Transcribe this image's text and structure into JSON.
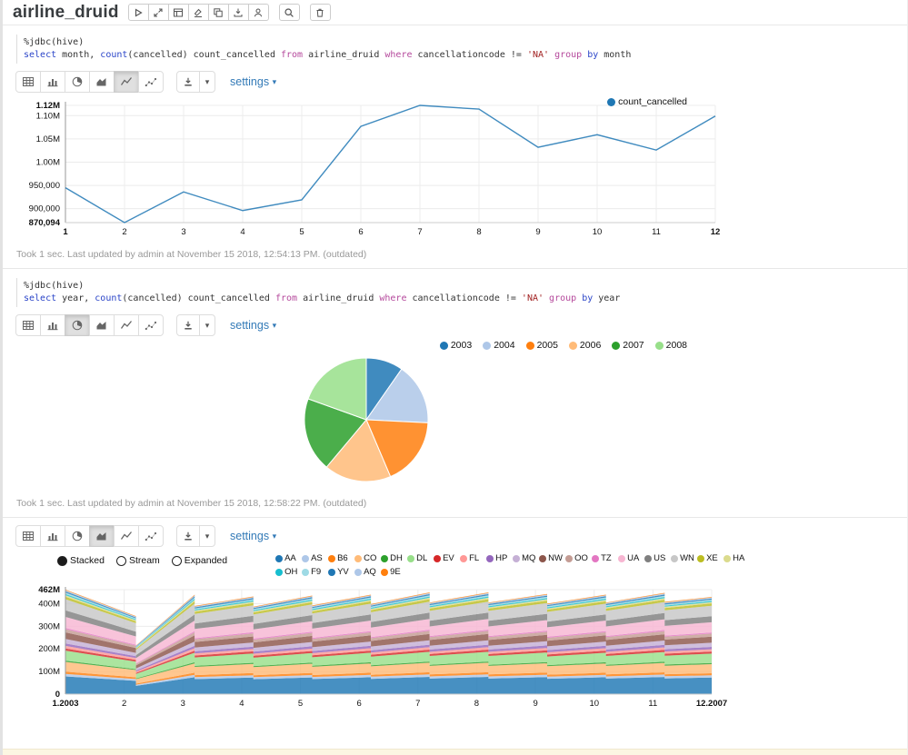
{
  "header": {
    "title": "airline_druid",
    "toolbar_buttons": [
      {
        "icon": "play",
        "name": "run-all-button"
      },
      {
        "icon": "expand",
        "name": "show-hide-code-button"
      },
      {
        "icon": "output",
        "name": "show-hide-output-button"
      },
      {
        "icon": "erase",
        "name": "clear-output-button"
      },
      {
        "icon": "clone",
        "name": "clone-note-button"
      },
      {
        "icon": "export",
        "name": "export-note-button"
      },
      {
        "icon": "commit",
        "name": "version-control-button"
      }
    ],
    "search_button": {
      "icon": "search",
      "name": "search-button"
    },
    "trash_button": {
      "icon": "trash",
      "name": "remove-note-button"
    }
  },
  "toolbar_common": {
    "chart_buttons": [
      "table",
      "bar",
      "pie",
      "area",
      "line",
      "scatter"
    ],
    "settings_label": "settings",
    "settings_caret": "▾",
    "download_caret": "▾"
  },
  "paragraphs": [
    {
      "name": "cancelled-by-month-paragraph",
      "code_lines": [
        [
          [
            "%jdbc(hive)",
            "pl"
          ]
        ],
        [
          [
            "select",
            "kw1"
          ],
          [
            " month, ",
            "pl"
          ],
          [
            "count",
            "kw1"
          ],
          [
            "(cancelled) count_cancelled ",
            "pl"
          ],
          [
            "from",
            "kw2"
          ],
          [
            " airline_druid ",
            "pl"
          ],
          [
            "where",
            "kw2"
          ],
          [
            " cancellationcode != ",
            "pl"
          ],
          [
            "'NA'",
            "str"
          ],
          [
            " ",
            "pl"
          ],
          [
            "group",
            "kw2"
          ],
          [
            " ",
            "pl"
          ],
          [
            "by",
            "kw1"
          ],
          [
            " month",
            "pl"
          ]
        ]
      ],
      "active_chart": "line",
      "status": "Took 1 sec. Last updated by admin at November 15 2018, 12:54:13 PM. (outdated)",
      "chart_data": {
        "type": "line",
        "x": [
          1,
          2,
          3,
          4,
          5,
          6,
          7,
          8,
          9,
          10,
          11,
          12
        ],
        "series": [
          {
            "name": "count_cancelled",
            "color": "#1f77b4",
            "values": [
              945000,
              870094,
              936000,
              896000,
              919000,
              1077000,
              1122000,
              1114000,
              1032000,
              1059000,
              1026000,
              1099000
            ]
          }
        ],
        "ylim": [
          870094,
          1122000
        ],
        "yticks": [
          {
            "label": "1.12M",
            "value": 1122000,
            "bold": true
          },
          {
            "label": "1.10M",
            "value": 1100000
          },
          {
            "label": "1.05M",
            "value": 1050000
          },
          {
            "label": "1.00M",
            "value": 1000000
          },
          {
            "label": "950,000",
            "value": 950000
          },
          {
            "label": "900,000",
            "value": 900000
          },
          {
            "label": "870,094",
            "value": 870094,
            "bold": true
          }
        ],
        "xticks": [
          {
            "label": "1",
            "pos": 1,
            "bold": true
          },
          {
            "label": "2",
            "pos": 2
          },
          {
            "label": "3",
            "pos": 3
          },
          {
            "label": "4",
            "pos": 4
          },
          {
            "label": "5",
            "pos": 5
          },
          {
            "label": "6",
            "pos": 6
          },
          {
            "label": "7",
            "pos": 7
          },
          {
            "label": "8",
            "pos": 8
          },
          {
            "label": "9",
            "pos": 9
          },
          {
            "label": "10",
            "pos": 10
          },
          {
            "label": "11",
            "pos": 11
          },
          {
            "label": "12",
            "pos": 12,
            "bold": true
          }
        ],
        "legend": [
          {
            "label": "count_cancelled",
            "color": "#1f77b4"
          }
        ],
        "legend_position": "top-right",
        "grid": true
      }
    },
    {
      "name": "cancelled-by-year-paragraph",
      "code_lines": [
        [
          [
            "%jdbc(hive)",
            "pl"
          ]
        ],
        [
          [
            "select",
            "kw1"
          ],
          [
            " year, ",
            "pl"
          ],
          [
            "count",
            "kw1"
          ],
          [
            "(cancelled) count_cancelled ",
            "pl"
          ],
          [
            "from",
            "kw2"
          ],
          [
            " airline_druid ",
            "pl"
          ],
          [
            "where",
            "kw2"
          ],
          [
            " cancellationcode != ",
            "pl"
          ],
          [
            "'NA'",
            "str"
          ],
          [
            " ",
            "pl"
          ],
          [
            "group",
            "kw2"
          ],
          [
            " ",
            "pl"
          ],
          [
            "by",
            "kw1"
          ],
          [
            " year",
            "pl"
          ]
        ]
      ],
      "active_chart": "pie",
      "status": "Took 1 sec. Last updated by admin at November 15 2018, 12:58:22 PM. (outdated)",
      "chart_data": {
        "type": "pie",
        "categories": [
          "2003",
          "2004",
          "2005",
          "2006",
          "2007",
          "2008"
        ],
        "values_pct": [
          9.7,
          16.1,
          17.8,
          17.5,
          19.4,
          19.5
        ],
        "colors": [
          "#1f77b4",
          "#aec7e8",
          "#ff7f0e",
          "#ffbb78",
          "#2ca02c",
          "#98df8a"
        ],
        "legend_position": "top-right"
      }
    },
    {
      "name": "stacked-area-paragraph",
      "code_lines": null,
      "active_chart": "area",
      "controls": {
        "radios": [
          {
            "label": "Stacked",
            "selected": true
          },
          {
            "label": "Stream",
            "selected": false
          },
          {
            "label": "Expanded",
            "selected": false
          }
        ]
      },
      "status": null,
      "chart_data": {
        "type": "area",
        "mode": "stacked",
        "unit": "millions",
        "ylim": [
          0,
          462
        ],
        "yticks": [
          {
            "label": "462M",
            "value": 462,
            "bold": true
          },
          {
            "label": "400M",
            "value": 400
          },
          {
            "label": "300M",
            "value": 300
          },
          {
            "label": "200M",
            "value": 200
          },
          {
            "label": "100M",
            "value": 100
          },
          {
            "label": "0",
            "value": 0,
            "bold": true
          }
        ],
        "xticks": [
          {
            "label": "1.2003",
            "pos": 1,
            "bold": true
          },
          {
            "label": "2",
            "pos": 2
          },
          {
            "label": "3",
            "pos": 3
          },
          {
            "label": "4",
            "pos": 4
          },
          {
            "label": "5",
            "pos": 5
          },
          {
            "label": "6",
            "pos": 6
          },
          {
            "label": "7",
            "pos": 7
          },
          {
            "label": "8",
            "pos": 8
          },
          {
            "label": "9",
            "pos": 9
          },
          {
            "label": "10",
            "pos": 10
          },
          {
            "label": "11",
            "pos": 11
          },
          {
            "label": "12.2007",
            "pos": 12,
            "bold": true
          }
        ],
        "series": [
          {
            "name": "AA",
            "color": "#1f77b4",
            "value": 71
          },
          {
            "name": "AS",
            "color": "#aec7e8",
            "value": 10
          },
          {
            "name": "B6",
            "color": "#ff7f0e",
            "value": 9
          },
          {
            "name": "CO",
            "color": "#ffbb78",
            "value": 39
          },
          {
            "name": "DH",
            "color": "#2ca02c",
            "value": 5
          },
          {
            "name": "DL",
            "color": "#98df8a",
            "value": 40
          },
          {
            "name": "EV",
            "color": "#d62728",
            "value": 9
          },
          {
            "name": "FL",
            "color": "#ff9896",
            "value": 10
          },
          {
            "name": "HP",
            "color": "#9467bd",
            "value": 10
          },
          {
            "name": "MQ",
            "color": "#c5b0d5",
            "value": 18
          },
          {
            "name": "NW",
            "color": "#8c564b",
            "value": 26
          },
          {
            "name": "OO",
            "color": "#c49c94",
            "value": 13
          },
          {
            "name": "TZ",
            "color": "#e377c2",
            "value": 5
          },
          {
            "name": "UA",
            "color": "#f7b6d2",
            "value": 44
          },
          {
            "name": "US",
            "color": "#7f7f7f",
            "value": 26
          },
          {
            "name": "WN",
            "color": "#c7c7c7",
            "value": 45
          },
          {
            "name": "XE",
            "color": "#bcbd22",
            "value": 10
          },
          {
            "name": "HA",
            "color": "#dbdb8d",
            "value": 6
          },
          {
            "name": "OH",
            "color": "#17becf",
            "value": 5
          },
          {
            "name": "F9",
            "color": "#9edae5",
            "value": 5
          },
          {
            "name": "YV",
            "color": "#1f77b4",
            "value": 5
          },
          {
            "name": "AQ",
            "color": "#aec7e8",
            "value": 4
          },
          {
            "name": "9E",
            "color": "#ff7f0e",
            "value": 3
          }
        ],
        "totals_profile": [
          [
            1,
            462
          ],
          [
            2.2,
            345
          ],
          [
            2.2,
            215
          ],
          [
            3.2,
            440
          ],
          [
            3.2,
            390
          ],
          [
            4.2,
            432
          ],
          [
            4.2,
            387
          ],
          [
            5.2,
            436
          ],
          [
            5.2,
            392
          ],
          [
            6.2,
            440
          ],
          [
            6.2,
            398
          ],
          [
            7.2,
            450
          ],
          [
            7.2,
            405
          ],
          [
            8.2,
            450
          ],
          [
            8.2,
            405
          ],
          [
            9.2,
            443
          ],
          [
            9.2,
            400
          ],
          [
            10.2,
            440
          ],
          [
            10.2,
            405
          ],
          [
            11.2,
            448
          ],
          [
            11.2,
            408
          ],
          [
            12,
            430
          ]
        ]
      }
    }
  ]
}
